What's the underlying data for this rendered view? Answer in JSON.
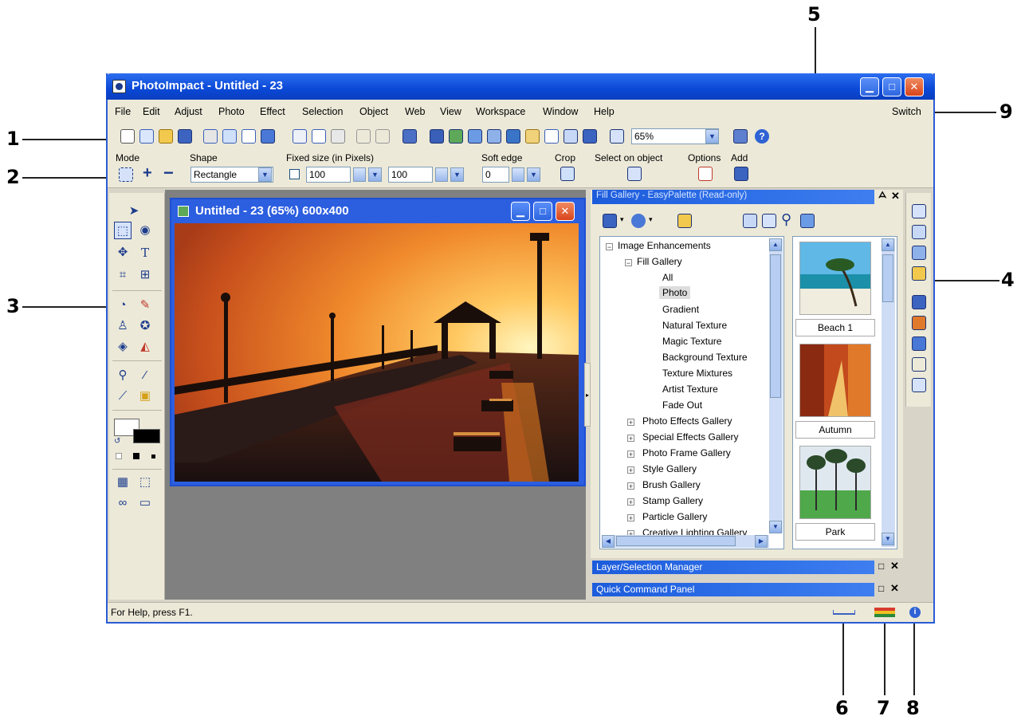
{
  "window": {
    "title": "PhotoImpact - Untitled - 23",
    "controls": {
      "minimize": "▁",
      "maximize": "□",
      "close": "✕"
    }
  },
  "menubar": {
    "items": [
      "File",
      "Edit",
      "Adjust",
      "Photo",
      "Effect",
      "Selection",
      "Object",
      "Web",
      "View",
      "Workspace",
      "Window",
      "Help"
    ],
    "switch_label": "Switch"
  },
  "toolbar": {
    "zoom_value": "65%"
  },
  "options": {
    "mode_label": "Mode",
    "shape_label": "Shape",
    "shape_value": "Rectangle",
    "fixed_size_label": "Fixed size (in Pixels)",
    "width_value": "100",
    "height_value": "100",
    "soft_edge_label": "Soft edge",
    "soft_edge_value": "0",
    "crop_label": "Crop",
    "select_on_object_label": "Select on object",
    "options_label": "Options",
    "add_label": "Add"
  },
  "document": {
    "title": "Untitled - 23 (65%) 600x400"
  },
  "gallery": {
    "title": "Fill Gallery - EasyPalette (Read-only)",
    "tree": {
      "root": "Image Enhancements",
      "fill_gallery": "Fill Gallery",
      "fill_children": [
        "All",
        "Photo",
        "Gradient",
        "Natural Texture",
        "Magic Texture",
        "Background Texture",
        "Texture Mixtures",
        "Artist Texture",
        "Fade Out"
      ],
      "selected": "Photo",
      "galleries": [
        "Photo Effects Gallery",
        "Special Effects Gallery",
        "Photo Frame Gallery",
        "Style Gallery",
        "Brush Gallery",
        "Stamp Gallery",
        "Particle Gallery",
        "Creative Lighting Gallery"
      ]
    },
    "thumbnails": [
      "Beach 1",
      "Autumn",
      "Park"
    ]
  },
  "panels": {
    "layer_manager": "Layer/Selection Manager",
    "quick_command": "Quick Command Panel"
  },
  "statusbar": {
    "help_text": "For Help, press F1."
  },
  "callouts": [
    "1",
    "2",
    "3",
    "4",
    "5",
    "6",
    "7",
    "8",
    "9"
  ],
  "colors": {
    "title_blue": "#0a48d6",
    "chrome": "#ece9d8",
    "close_red": "#d8441c"
  }
}
